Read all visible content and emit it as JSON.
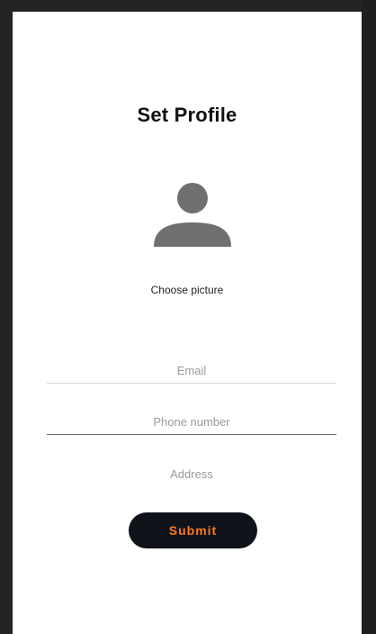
{
  "header": {
    "title": "Set Profile"
  },
  "profile_picture": {
    "icon": "user-avatar-icon",
    "choose_label": "Choose picture"
  },
  "form": {
    "email": {
      "value": "",
      "placeholder": "Email"
    },
    "phone": {
      "value": "",
      "placeholder": "Phone number"
    },
    "address": {
      "value": "",
      "placeholder": "Address"
    },
    "submit_label": "Submit"
  },
  "colors": {
    "background": "#ffffff",
    "frame": "#232323",
    "avatar_icon": "#707070",
    "submit_bg": "#0f1218",
    "submit_text": "#ff7a1a"
  }
}
